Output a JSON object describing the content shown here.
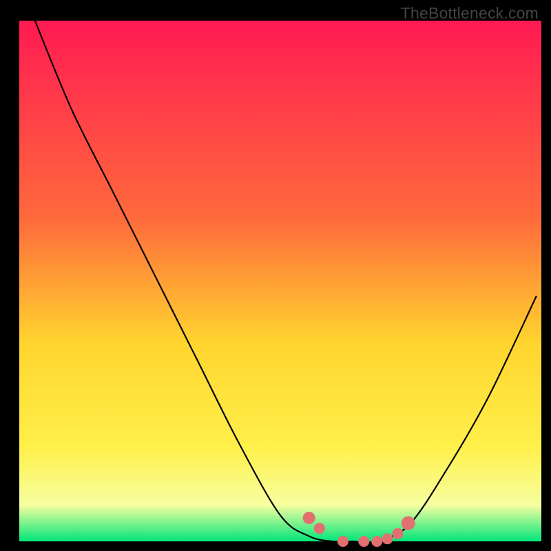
{
  "watermark": "TheBottleneck.com",
  "colors": {
    "bg": "#000000",
    "curve": "#000000",
    "markers": "#e27070",
    "grad_top": "#ff1a52",
    "grad_mid1": "#ff6a3c",
    "grad_mid2": "#ffd52e",
    "grad_mid3": "#fff04a",
    "grad_mid4": "#f7ffa0",
    "grad_bot": "#00e67a"
  },
  "chart_data": {
    "type": "line",
    "title": "",
    "xlabel": "",
    "ylabel": "",
    "x": [
      0.03,
      0.1,
      0.18,
      0.26,
      0.34,
      0.42,
      0.5,
      0.555,
      0.6,
      0.64,
      0.68,
      0.745,
      0.82,
      0.9,
      0.99
    ],
    "values": [
      1.0,
      0.83,
      0.67,
      0.51,
      0.35,
      0.19,
      0.05,
      0.01,
      0.0,
      0.0,
      0.0,
      0.03,
      0.14,
      0.28,
      0.47
    ],
    "xlim": [
      0,
      1
    ],
    "ylim": [
      0,
      1
    ],
    "markers_x": [
      0.555,
      0.575,
      0.62,
      0.66,
      0.685,
      0.705,
      0.725,
      0.745
    ],
    "markers_y": [
      0.045,
      0.025,
      0.0,
      0.0,
      0.0,
      0.005,
      0.015,
      0.035
    ],
    "markers_r": [
      9,
      8,
      8,
      8,
      8,
      8,
      8,
      10
    ]
  }
}
